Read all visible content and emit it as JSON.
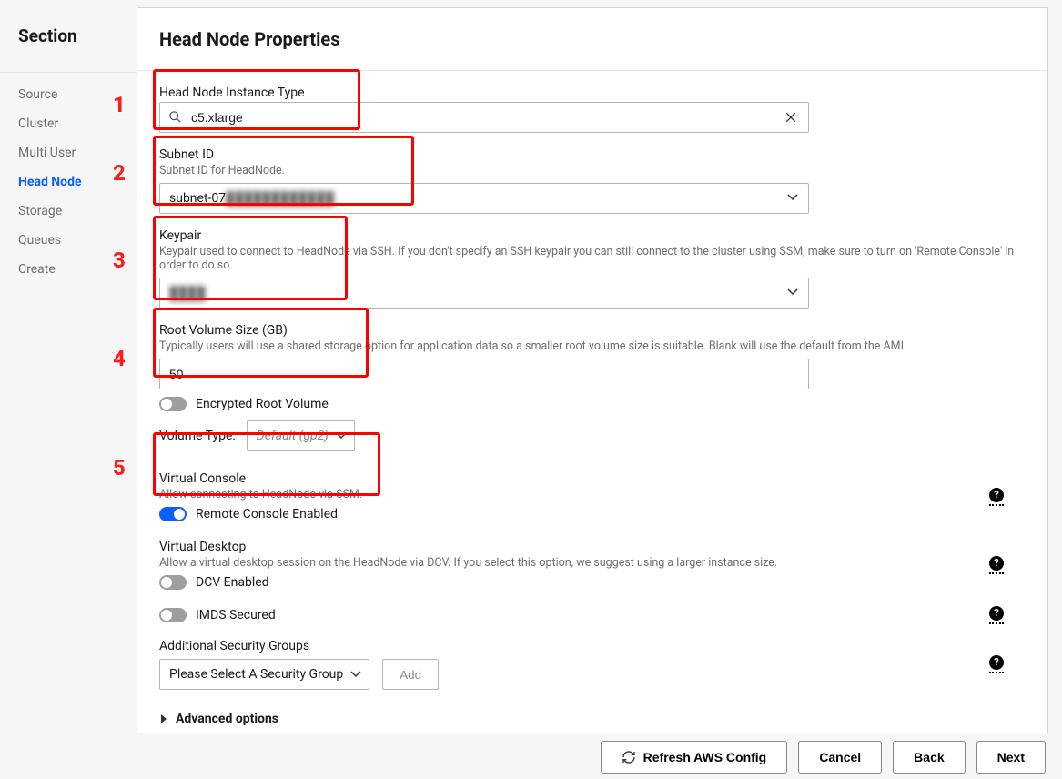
{
  "sidebar": {
    "title": "Section",
    "items": [
      {
        "label": "Source",
        "active": false
      },
      {
        "label": "Cluster",
        "active": false
      },
      {
        "label": "Multi User",
        "active": false
      },
      {
        "label": "Head Node",
        "active": true
      },
      {
        "label": "Storage",
        "active": false
      },
      {
        "label": "Queues",
        "active": false
      },
      {
        "label": "Create",
        "active": false
      }
    ]
  },
  "header": {
    "title": "Head Node Properties"
  },
  "fields": {
    "instance_type": {
      "label": "Head Node Instance Type",
      "value": "c5.xlarge"
    },
    "subnet": {
      "label": "Subnet ID",
      "hint": "Subnet ID for HeadNode.",
      "value": "subnet-07",
      "blurred_rest": "████████████"
    },
    "keypair": {
      "label": "Keypair",
      "hint": "Keypair used to connect to HeadNode via SSH. If you don't specify an SSH keypair you can still connect to the cluster using SSM, make sure to turn on 'Remote Console' in order to do so.",
      "value_blurred": "████"
    },
    "root_volume": {
      "label": "Root Volume Size (GB)",
      "hint": "Typically users will use a shared storage option for application data so a smaller root volume size is suitable. Blank will use the default from the AMI.",
      "value": "50"
    },
    "encrypted": {
      "label": "Encrypted Root Volume",
      "on": false
    },
    "volume_type": {
      "label": "Volume Type:",
      "value": "Default (gp2)"
    },
    "virtual_console": {
      "label": "Virtual Console",
      "hint": "Allow connecting to HeadNode via SSM.",
      "toggle_label": "Remote Console Enabled",
      "on": true
    },
    "virtual_desktop": {
      "label": "Virtual Desktop",
      "hint": "Allow a virtual desktop session on the HeadNode via DCV. If you select this option, we suggest using a larger instance size.",
      "toggle_label": "DCV Enabled",
      "on": false
    },
    "imds": {
      "label": "IMDS Secured",
      "on": false
    },
    "security_groups": {
      "label": "Additional Security Groups",
      "placeholder": "Please Select A Security Group",
      "add": "Add"
    },
    "advanced": "Advanced options"
  },
  "footer": {
    "refresh": "Refresh AWS Config",
    "cancel": "Cancel",
    "back": "Back",
    "next": "Next"
  },
  "annotations": [
    "1",
    "2",
    "3",
    "4",
    "5"
  ]
}
